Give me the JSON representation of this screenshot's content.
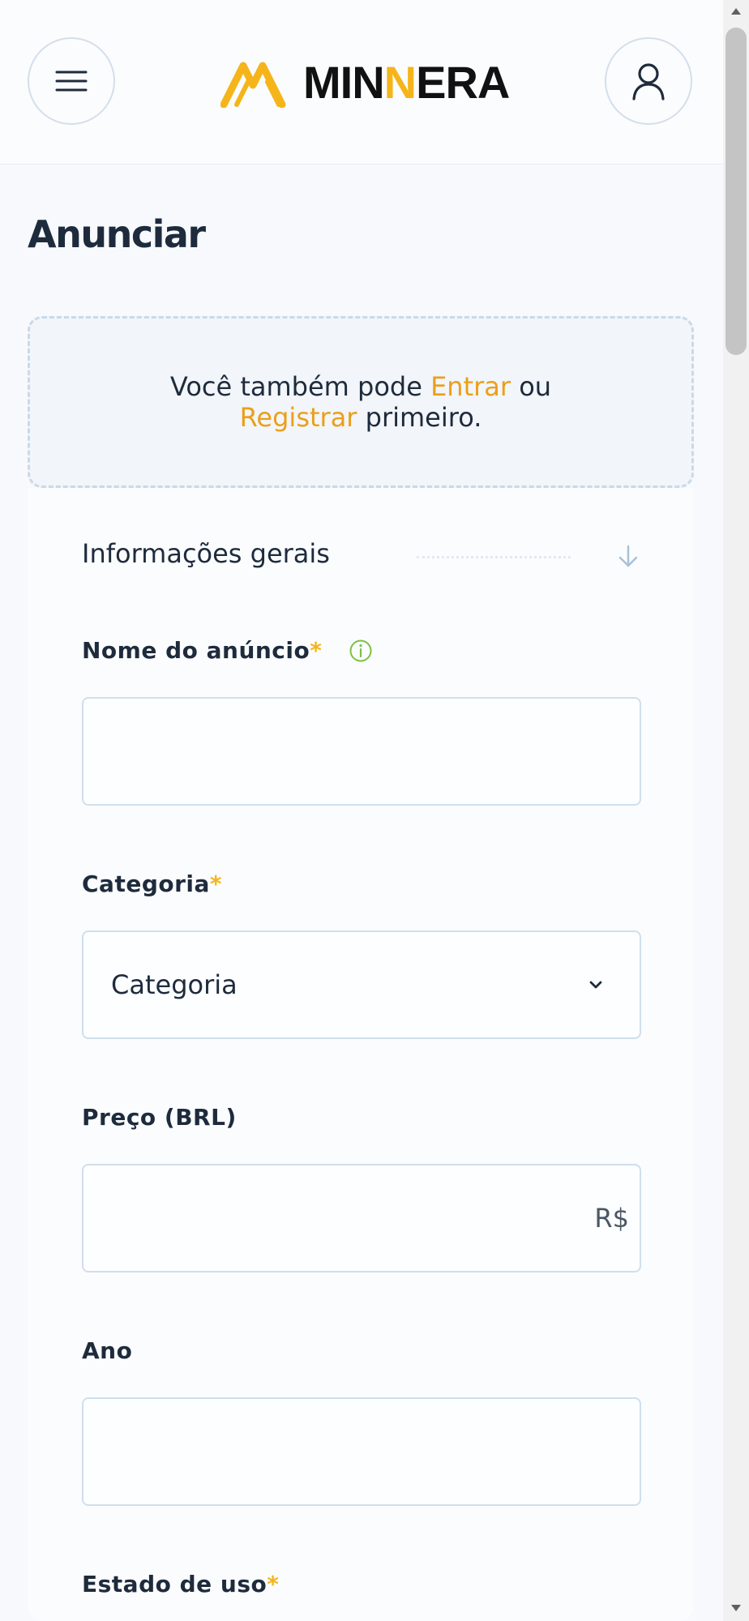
{
  "header": {
    "logo_parts": [
      "MIN",
      "N",
      "ERA"
    ],
    "menu_icon": "hamburger-menu-icon",
    "account_icon": "user-icon"
  },
  "page": {
    "title": "Anunciar"
  },
  "notice": {
    "prefix": "Você também pode ",
    "login_link": "Entrar",
    "middle": " ou ",
    "register_link": "Registrar",
    "suffix": " primeiro."
  },
  "form": {
    "section_title": "Informações gerais",
    "required_marker": "*",
    "fields": {
      "name": {
        "label": "Nome do anúncio",
        "value": ""
      },
      "category": {
        "label": "Categoria",
        "selected": "Categoria"
      },
      "price": {
        "label": "Preço (BRL)",
        "value": "",
        "suffix": "R$"
      },
      "year": {
        "label": "Ano",
        "value": ""
      },
      "condition": {
        "label": "Estado de uso"
      }
    }
  },
  "colors": {
    "accent": "#f5b51a",
    "link": "#eb9f19",
    "text": "#1e2b3c",
    "border": "#cfdfec",
    "info": "#7bc043"
  }
}
